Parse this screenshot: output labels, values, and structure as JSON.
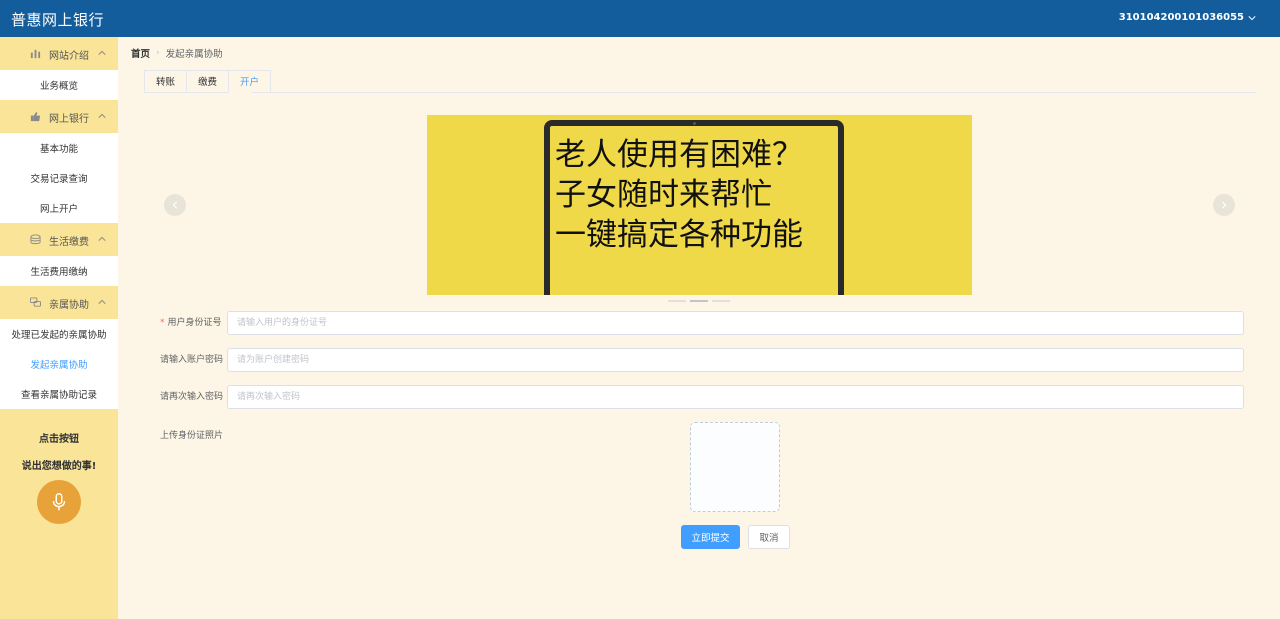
{
  "header": {
    "title": "普惠网上银行",
    "account": "310104200101036055"
  },
  "sidebar": {
    "groups": [
      {
        "label": "网站介绍",
        "icon": "chart-icon",
        "items": [
          "业务概览"
        ]
      },
      {
        "label": "网上银行",
        "icon": "thumbs-up-icon",
        "items": [
          "基本功能",
          "交易记录查询",
          "网上开户"
        ]
      },
      {
        "label": "生活缴费",
        "icon": "coins-icon",
        "items": [
          "生活费用缴纳"
        ]
      },
      {
        "label": "亲属协助",
        "icon": "chat-icon",
        "items": [
          "处理已发起的亲属协助",
          "发起亲属协助",
          "查看亲属协助记录"
        ]
      }
    ],
    "active_item": "发起亲属协助",
    "voice": {
      "line1": "点击按钮",
      "line2": "说出您想做的事!"
    }
  },
  "breadcrumb": {
    "home": "首页",
    "current": "发起亲属协助"
  },
  "tabs": [
    "转账",
    "缴费",
    "开户"
  ],
  "active_tab": "开户",
  "carousel": {
    "lines": [
      "老人使用有困难？",
      "子女随时来帮忙",
      "一键搞定各种功能"
    ],
    "active_index": 1,
    "count": 3
  },
  "form": {
    "id_label": "用户身份证号",
    "id_placeholder": "请输入用户的身份证号",
    "id_required_mark": "*",
    "password_label": "请输入账户密码",
    "password_placeholder": "请为账户创建密码",
    "confirm_label": "请再次输入密码",
    "confirm_placeholder": "请再次输入密码",
    "upload_label": "上传身份证照片",
    "submit": "立即提交",
    "cancel": "取消"
  },
  "colors": {
    "header_bg": "#135d9c",
    "sidebar_bg": "#f9e497",
    "page_bg": "#fdf6e6",
    "accent": "#409eff",
    "mic_bg": "#e8a23a",
    "banner_bg": "#f0d948"
  }
}
